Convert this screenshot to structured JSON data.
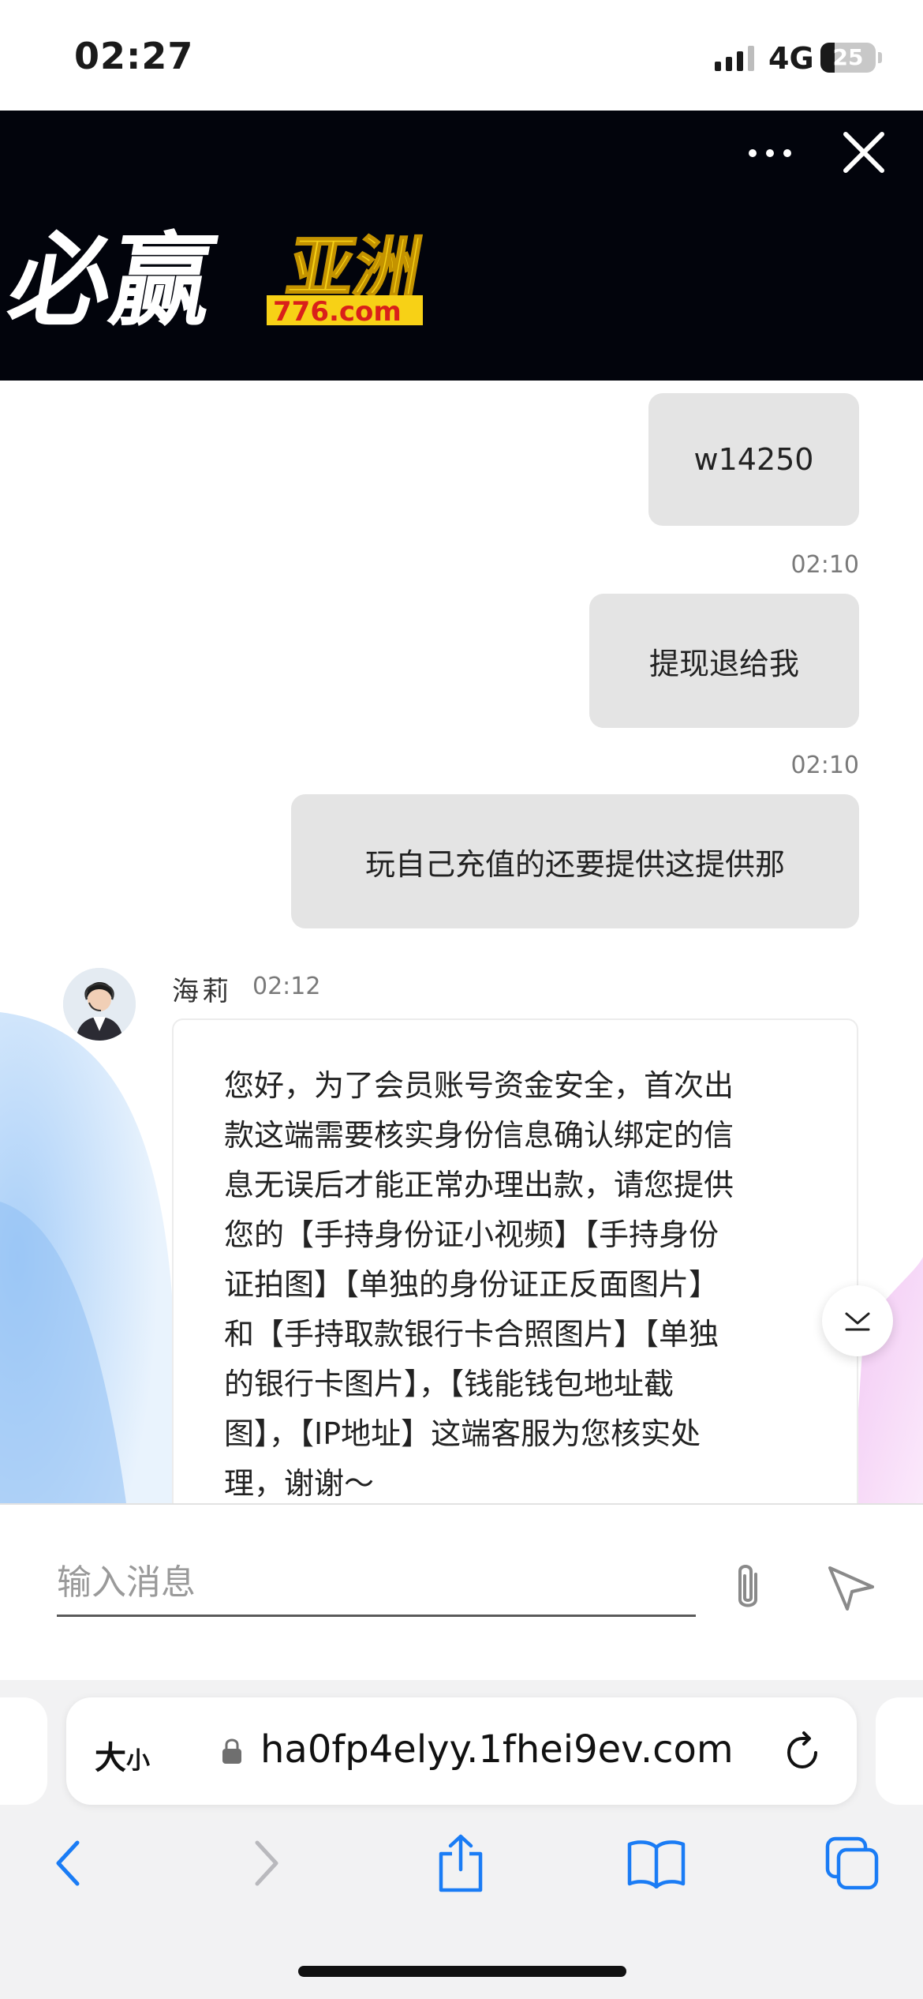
{
  "status_bar": {
    "time": "02:27",
    "network": "4G",
    "battery": "25",
    "battery_level": 0.25
  },
  "banner": {
    "logo_text_main": "必赢",
    "logo_text_side": "亚洲",
    "logo_domain": "776.com",
    "colors": {
      "background": "#02040c",
      "logo_white": "#ffffff",
      "logo_yellow": "#f7d116",
      "logo_red": "#d9201a"
    }
  },
  "chat": {
    "messages_out": [
      {
        "text": "w14250",
        "time": "02:10"
      },
      {
        "text": "提现退给我",
        "time": "02:10"
      },
      {
        "text": "玩自己充值的还要提供这提供那",
        "time": ""
      }
    ],
    "agent": {
      "name": "海莉",
      "time": "02:12",
      "lines": [
        "您好，为了会员账号资金安全，首次出",
        "款这端需要核实身份信息确认绑定的信",
        "息无误后才能正常办理出款，请您提供",
        "您的【手持身份证小视频】【手持身份",
        "证拍图】【单独的身份证正反面图片】",
        "和【手持取款银行卡合照图片】【单独",
        "的银行卡图片】，【钱能钱包地址截",
        "图】，【IP地址】这端客服为您核实处",
        "理，谢谢～"
      ]
    }
  },
  "input": {
    "placeholder": "输入消息",
    "value": ""
  },
  "browser": {
    "text_size_big": "大",
    "text_size_small": "小",
    "url": "ha0fp4elyy.1fhei9ev.com",
    "tint_color": "#1a7cf5"
  }
}
